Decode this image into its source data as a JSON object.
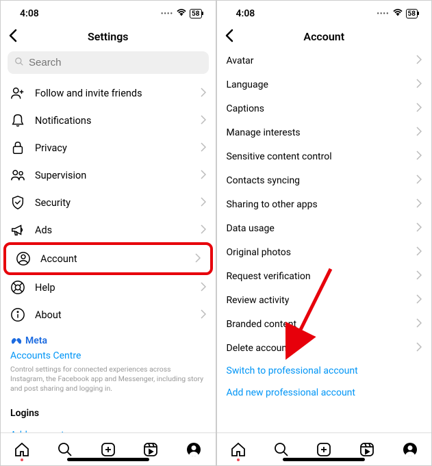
{
  "status": {
    "time": "4:08",
    "battery": "58"
  },
  "left": {
    "title": "Settings",
    "search_placeholder": "Search",
    "items": [
      {
        "label": "Follow and invite friends"
      },
      {
        "label": "Notifications"
      },
      {
        "label": "Privacy"
      },
      {
        "label": "Supervision"
      },
      {
        "label": "Security"
      },
      {
        "label": "Ads"
      },
      {
        "label": "Account"
      },
      {
        "label": "Help"
      },
      {
        "label": "About"
      }
    ],
    "meta": {
      "brand": "Meta",
      "accounts_centre": "Accounts Centre",
      "desc": "Control settings for connected experiences across Instagram, the Facebook app and Messenger, including story and post sharing and logging in."
    },
    "logins_header": "Logins",
    "add_account": "Add account"
  },
  "right": {
    "title": "Account",
    "items": [
      {
        "label": "Avatar"
      },
      {
        "label": "Language"
      },
      {
        "label": "Captions"
      },
      {
        "label": "Manage interests"
      },
      {
        "label": "Sensitive content control"
      },
      {
        "label": "Contacts syncing"
      },
      {
        "label": "Sharing to other apps"
      },
      {
        "label": "Data usage"
      },
      {
        "label": "Original photos"
      },
      {
        "label": "Request verification"
      },
      {
        "label": "Review activity"
      },
      {
        "label": "Branded content"
      },
      {
        "label": "Delete account"
      }
    ],
    "switch_pro": "Switch to professional account",
    "add_pro": "Add new professional account"
  }
}
